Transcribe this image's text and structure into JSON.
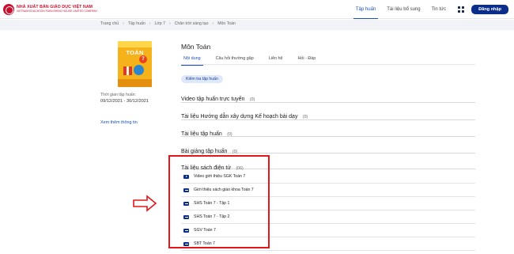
{
  "header": {
    "logo_line1": "NHÀ XUẤT BẢN GIÁO DỤC VIỆT NAM",
    "logo_line2": "VIETNAM EDUCATION PUBLISHING HOUSE LIMITED COMPANY",
    "nav": [
      {
        "label": "Tập huấn",
        "active": true
      },
      {
        "label": "Tài liệu bổ sung",
        "active": false
      },
      {
        "label": "Tin tức",
        "active": false
      }
    ],
    "login_label": "Đăng nhập"
  },
  "breadcrumb": [
    "Trang chủ",
    "Tập huấn",
    "Lớp 7",
    "Chân trời sáng tạo",
    "Môn Toán"
  ],
  "book": {
    "cover_title": "TOÁN",
    "cover_number": "7",
    "period_label": "Thời gian tập huấn:",
    "period_value": "09/12/2021 - 30/12/2021",
    "more_info": "Xem thêm thông tin"
  },
  "course": {
    "title": "Môn Toán",
    "tabs": [
      {
        "label": "Nội dung",
        "active": true
      },
      {
        "label": "Câu hỏi thường gặp",
        "active": false
      },
      {
        "label": "Liên hệ",
        "active": false
      },
      {
        "label": "Hỏi - Đáp",
        "active": false
      }
    ],
    "test_button": "Kiểm tra tập huấn"
  },
  "sections": [
    {
      "title": "Video tập huấn trực tuyến",
      "count": "(0)"
    },
    {
      "title": "Tài liệu Hướng dẫn xây dựng Kế hoạch bài dạy",
      "count": "(0)"
    },
    {
      "title": "Tài liệu tập huấn",
      "count": "(0)"
    },
    {
      "title": "Bài giảng tập huấn",
      "count": "(0)"
    },
    {
      "title": "Tài liệu sách điện tử",
      "count": "(06)"
    }
  ],
  "files": [
    {
      "label": "Video giới thiệu SGK Toán 7",
      "icon": "video-icon"
    },
    {
      "label": "Giới thiệu sách giáo khoa Toán 7",
      "icon": "document-icon"
    },
    {
      "label": "SHS Toán 7 - Tập 1",
      "icon": "document-icon"
    },
    {
      "label": "SHS Toán 7 - Tập 2",
      "icon": "document-icon"
    },
    {
      "label": "SGV Toán 7",
      "icon": "document-icon"
    },
    {
      "label": "SBT Toán 7",
      "icon": "document-icon"
    }
  ],
  "colors": {
    "accent": "#1b4fb8",
    "login_bg": "#0b2e8a",
    "annotation_red": "#e3161c"
  }
}
